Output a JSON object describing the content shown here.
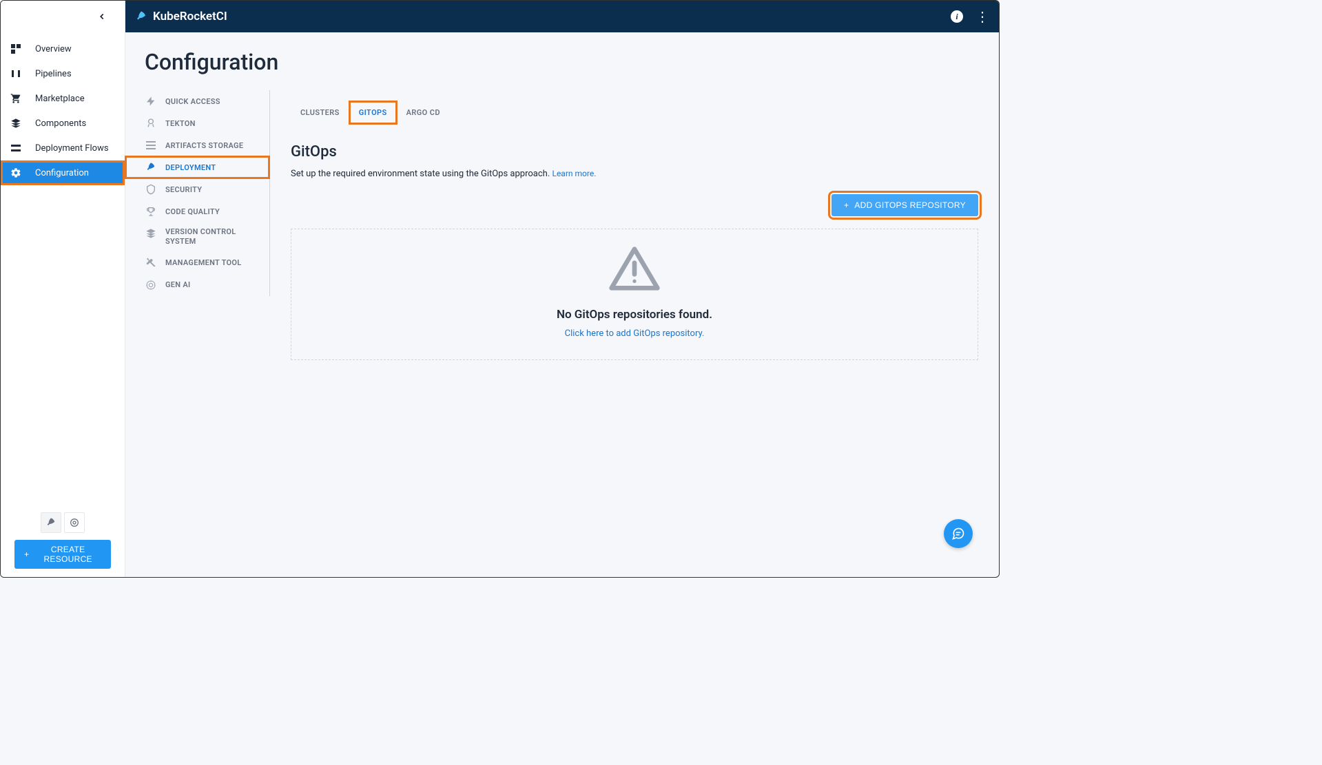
{
  "header": {
    "title": "KubeRocketCI"
  },
  "sidebar": {
    "items": [
      {
        "label": "Overview"
      },
      {
        "label": "Pipelines"
      },
      {
        "label": "Marketplace"
      },
      {
        "label": "Components"
      },
      {
        "label": "Deployment Flows"
      },
      {
        "label": "Configuration"
      }
    ],
    "createButton": "CREATE RESOURCE"
  },
  "pageTitle": "Configuration",
  "configNav": {
    "items": [
      {
        "label": "QUICK ACCESS"
      },
      {
        "label": "TEKTON"
      },
      {
        "label": "ARTIFACTS STORAGE"
      },
      {
        "label": "DEPLOYMENT"
      },
      {
        "label": "SECURITY"
      },
      {
        "label": "CODE QUALITY"
      },
      {
        "label": "VERSION CONTROL SYSTEM"
      },
      {
        "label": "MANAGEMENT TOOL"
      },
      {
        "label": "GEN AI"
      }
    ]
  },
  "tabs": [
    {
      "label": "CLUSTERS"
    },
    {
      "label": "GITOPS"
    },
    {
      "label": "ARGO CD"
    }
  ],
  "section": {
    "title": "GitOps",
    "description": "Set up the required environment state using the GitOps approach.",
    "learnMore": "Learn more.",
    "addButton": "ADD GITOPS REPOSITORY"
  },
  "emptyState": {
    "title": "No GitOps repositories found.",
    "link": "Click here to add GitOps repository."
  }
}
